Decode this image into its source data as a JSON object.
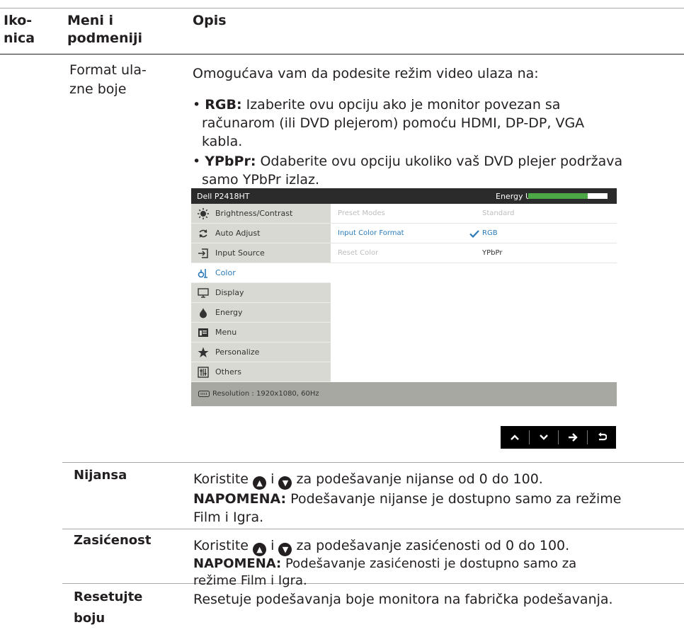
{
  "header": {
    "col1": [
      "Iko-",
      "nica"
    ],
    "col2": [
      "Meni i",
      "podmeniji"
    ],
    "col3": "Opis"
  },
  "rows": {
    "format": {
      "label": [
        "Format ula-",
        "zne boje"
      ],
      "intro": "Omogućava vam da podesite režim video ulaza na:",
      "rgb_term": "RGB:",
      "rgb_lines": [
        " Izaberite ovu opciju ako je monitor povezan sa",
        "računarom (ili DVD plejerom) pomoću HDMI, DP-DP, VGA",
        "kabla."
      ],
      "ypbpr_term": "YPbPr:",
      "ypbpr_lines": [
        " Odaberite ovu opciju ukoliko vaš DVD plejer podržava",
        "samo YPbPr izlaz."
      ]
    },
    "nijansa": {
      "label": "Nijansa",
      "line_a": "Koristite",
      "line_b": "i",
      "line_c": "za podešavanje nijanse od 0 do 100.",
      "note_term": "NAPOMENA:",
      "note_lines": [
        " Podešavanje nijanse je dostupno samo za režime",
        "Film i Igra."
      ]
    },
    "zasicenost": {
      "label": "Zasićenost",
      "line_a": "Koristite",
      "line_b": "i",
      "line_c": " za podešavanje zasićenosti od 0 do 100.",
      "note_term": "NAPOMENA:",
      "note_lines": [
        " Podešavanje zasićenosti je dostupno samo za",
        "režime Film i Igra."
      ]
    },
    "reset": {
      "label": [
        "Resetujte",
        "boju"
      ],
      "desc": "Resetuje podešavanja boje monitora na fabrička podešavanja."
    }
  },
  "osd": {
    "model": "Dell P2418HT",
    "energy_label": "Energy Use",
    "energy_level": 0.75,
    "menu": [
      {
        "label": "Brightness/Contrast",
        "icon": "sun-icon"
      },
      {
        "label": "Auto Adjust",
        "icon": "auto-adjust-icon"
      },
      {
        "label": "Input Source",
        "icon": "input-source-icon"
      },
      {
        "label": "Color",
        "icon": "color-icon"
      },
      {
        "label": "Display",
        "icon": "monitor-icon"
      },
      {
        "label": "Energy",
        "icon": "energy-icon"
      },
      {
        "label": "Menu",
        "icon": "menu-icon"
      },
      {
        "label": "Personalize",
        "icon": "star-icon"
      },
      {
        "label": "Others",
        "icon": "others-icon"
      }
    ],
    "rows": [
      {
        "key": "Preset Modes",
        "value": "Standard"
      },
      {
        "key": "Input Color Format",
        "value": "RGB"
      },
      {
        "key": "Reset Color",
        "value": "YPbPr"
      }
    ],
    "resolution": "Resolution : 1920x1080, 60Hz",
    "colors": {
      "accent": "#2a7ab8",
      "energy": "#4ca846"
    }
  },
  "nav_buttons": [
    "up-icon",
    "down-icon",
    "right-arrow-icon",
    "back-icon"
  ]
}
